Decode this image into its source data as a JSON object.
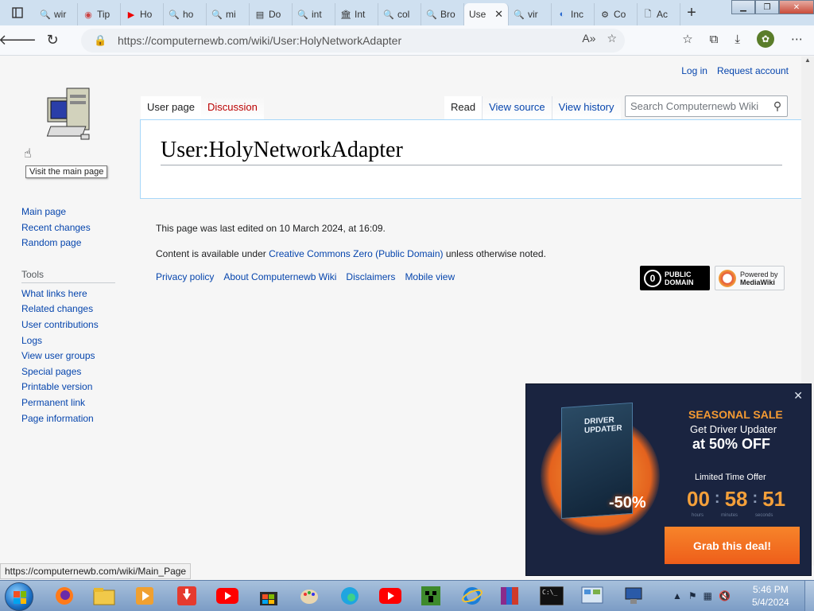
{
  "browser": {
    "tabs": [
      {
        "label": "wir",
        "icon": "search-icon",
        "active": false
      },
      {
        "label": "Tip",
        "icon": "tip-icon",
        "active": false
      },
      {
        "label": "Ho",
        "icon": "youtube-icon",
        "active": false
      },
      {
        "label": "ho",
        "icon": "search-icon",
        "active": false
      },
      {
        "label": "mi",
        "icon": "search-icon",
        "active": false
      },
      {
        "label": "Do",
        "icon": "doc-icon",
        "active": false
      },
      {
        "label": "int",
        "icon": "search-icon",
        "active": false
      },
      {
        "label": "Int",
        "icon": "archive-icon",
        "active": false
      },
      {
        "label": "col",
        "icon": "search-icon",
        "active": false
      },
      {
        "label": "Bro",
        "icon": "search-icon",
        "active": false
      },
      {
        "label": "Use",
        "icon": "search-icon",
        "active": true
      },
      {
        "label": "vir",
        "icon": "search-icon",
        "active": false
      },
      {
        "label": "Inc",
        "icon": "incognito-icon",
        "active": false
      },
      {
        "label": "Co",
        "icon": "co-icon",
        "active": false
      },
      {
        "label": "Ac",
        "icon": "page-icon",
        "active": false
      }
    ],
    "url": "https://computernewb.com/wiki/User:HolyNetworkAdapter"
  },
  "page": {
    "personal": {
      "login": "Log in",
      "request": "Request account"
    },
    "tooltip": "Visit the main page",
    "nav": {
      "main": [
        "Main page",
        "Recent changes",
        "Random page"
      ],
      "tools_heading": "Tools",
      "tools": [
        "What links here",
        "Related changes",
        "User contributions",
        "Logs",
        "View user groups",
        "Special pages",
        "Printable version",
        "Permanent link",
        "Page information"
      ]
    },
    "tabs": {
      "user_page": "User page",
      "discussion": "Discussion",
      "read": "Read",
      "view_source": "View source",
      "view_history": "View history"
    },
    "search_placeholder": "Search Computernewb Wiki",
    "title": "User:HolyNetworkAdapter",
    "footer": {
      "last_edited": "This page was last edited on 10 March 2024, at 16:09.",
      "license_pre": "Content is available under ",
      "license_link": "Creative Commons Zero (Public Domain)",
      "license_post": " unless otherwise noted.",
      "places": [
        "Privacy policy",
        "About Computernewb Wiki",
        "Disclaimers",
        "Mobile view"
      ],
      "badge_pd": [
        "PUBLIC",
        "DOMAIN"
      ],
      "badge_mw": [
        "Powered by",
        "MediaWiki"
      ]
    }
  },
  "ad": {
    "box_title": [
      "DRIVER",
      "UPDATER"
    ],
    "discount_badge": "-50%",
    "sale": "SEASONAL SALE",
    "get": "Get Driver Updater",
    "off": "at 50% OFF",
    "limited": "Limited Time Offer",
    "timer": {
      "hours": "00",
      "minutes": "58",
      "seconds": "51"
    },
    "timer_labels": [
      "hours",
      "minutes",
      "seconds"
    ],
    "cta": "Grab this deal!"
  },
  "status_url": "https://computernewb.com/wiki/Main_Page",
  "taskbar": {
    "time": "5:46 PM",
    "date": "5/4/2024"
  },
  "colors": {
    "link": "#0645ad",
    "discussion_red": "#ba0000",
    "ad_orange": "#f59a32"
  }
}
